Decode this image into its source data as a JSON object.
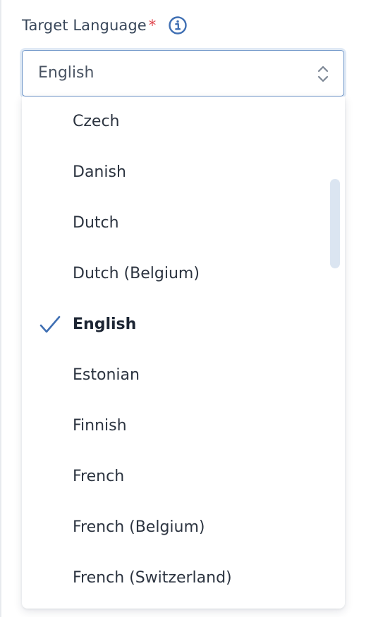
{
  "field": {
    "label": "Target Language",
    "required_marker": "*",
    "info_icon": "info-circle-icon",
    "selected_value": "English"
  },
  "dropdown": {
    "options": [
      {
        "label": "Czech",
        "selected": false
      },
      {
        "label": "Danish",
        "selected": false
      },
      {
        "label": "Dutch",
        "selected": false
      },
      {
        "label": "Dutch (Belgium)",
        "selected": false
      },
      {
        "label": "English",
        "selected": true
      },
      {
        "label": "Estonian",
        "selected": false
      },
      {
        "label": "Finnish",
        "selected": false
      },
      {
        "label": "French",
        "selected": false
      },
      {
        "label": "French (Belgium)",
        "selected": false
      },
      {
        "label": "French (Switzerland)",
        "selected": false
      }
    ]
  },
  "colors": {
    "accent": "#3f6fb3",
    "required": "#e0464e",
    "label_text": "#39475a",
    "select_border": "#6c94c8",
    "scrollbar": "#dbe5f1"
  }
}
